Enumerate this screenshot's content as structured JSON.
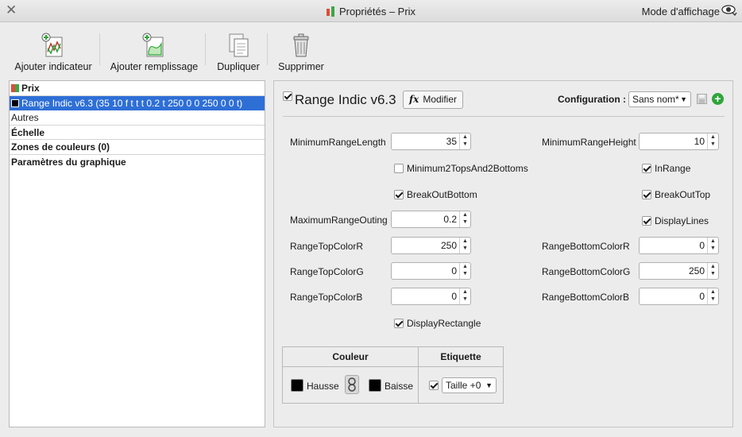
{
  "window": {
    "title": "Propriétés – Prix",
    "mode_label": "Mode d'affichage",
    "close_icon": "close-icon",
    "mode_icon": "eye-icon"
  },
  "toolbar": {
    "buttons": [
      {
        "label": "Ajouter indicateur",
        "icon": "add-indicator-icon"
      },
      {
        "label": "Ajouter remplissage",
        "icon": "add-fill-icon"
      },
      {
        "label": "Dupliquer",
        "icon": "duplicate-icon"
      },
      {
        "label": "Supprimer",
        "icon": "trash-icon"
      }
    ]
  },
  "tree": {
    "items": [
      {
        "label": "Prix",
        "bold": true,
        "icon": "price-chart-icon"
      },
      {
        "label": "Range Indic v6.3 (35 10 f t t t 0.2 t 250 0 0 250 0 0 t)",
        "selected": true,
        "icon": "black-swatch-icon"
      },
      {
        "label": "Autres"
      },
      {
        "label": "Échelle",
        "bold": true
      },
      {
        "label": "Zones de couleurs (0)",
        "bold": true
      },
      {
        "label": "Paramètres du graphique",
        "bold": true
      }
    ]
  },
  "indicator": {
    "name": "Range Indic v6.3",
    "enabled": true,
    "modify_label": "Modifier",
    "fx_symbol": "fx",
    "config_label": "Configuration :",
    "config_value": "Sans nom*"
  },
  "params": {
    "MinimumRangeLength": {
      "label": "MinimumRangeLength",
      "value": "35"
    },
    "MinimumRangeHeight": {
      "label": "MinimumRangeHeight",
      "value": "10"
    },
    "Minimum2TopsAnd2Bottoms": {
      "label": "Minimum2TopsAnd2Bottoms",
      "checked": false
    },
    "InRange": {
      "label": "InRange",
      "checked": true
    },
    "BreakOutBottom": {
      "label": "BreakOutBottom",
      "checked": true
    },
    "BreakOutTop": {
      "label": "BreakOutTop",
      "checked": true
    },
    "MaximumRangeOuting": {
      "label": "MaximumRangeOuting",
      "value": "0.2"
    },
    "DisplayLines": {
      "label": "DisplayLines",
      "checked": true
    },
    "RangeTopColorR": {
      "label": "RangeTopColorR",
      "value": "250"
    },
    "RangeBottomColorR": {
      "label": "RangeBottomColorR",
      "value": "0"
    },
    "RangeTopColorG": {
      "label": "RangeTopColorG",
      "value": "0"
    },
    "RangeBottomColorG": {
      "label": "RangeBottomColorG",
      "value": "250"
    },
    "RangeTopColorB": {
      "label": "RangeTopColorB",
      "value": "0"
    },
    "RangeBottomColorB": {
      "label": "RangeBottomColorB",
      "value": "0"
    },
    "DisplayRectangle": {
      "label": "DisplayRectangle",
      "checked": true
    }
  },
  "style_table": {
    "col_color": "Couleur",
    "col_label": "Etiquette",
    "up_label": "Hausse",
    "down_label": "Baisse",
    "up_color": "#000000",
    "down_color": "#000000",
    "label_enabled": true,
    "label_size": "Taille +0"
  },
  "colors": {
    "selection": "#2e6fd6",
    "add_green": "#2fa53a"
  }
}
